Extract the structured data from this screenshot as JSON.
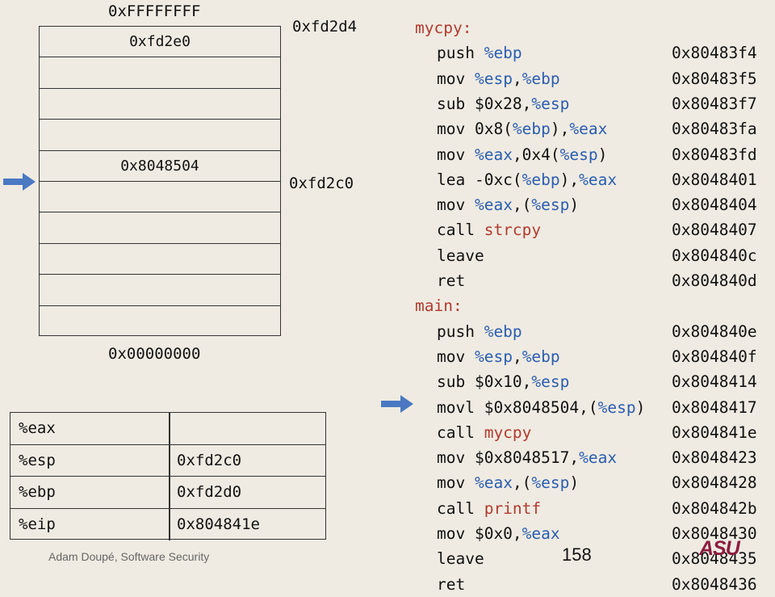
{
  "stack": {
    "top_address_label": "0xFFFFFFFF",
    "bottom_address_label": "0x00000000",
    "side_labels": [
      "0xfd2d4",
      "0xfd2c0"
    ],
    "cells": [
      "0xfd2e0",
      "",
      "",
      "",
      "0x8048504",
      "",
      "",
      "",
      "",
      ""
    ]
  },
  "registers": [
    {
      "name": "%eax",
      "value": ""
    },
    {
      "name": "%esp",
      "value": "0xfd2c0"
    },
    {
      "name": "%ebp",
      "value": "0xfd2d0"
    },
    {
      "name": "%eip",
      "value": "0x804841e"
    }
  ],
  "asm": {
    "mycpy_label": "mycpy:",
    "main_label": "main:",
    "mycpy": [
      {
        "parts": [
          {
            "t": "push ",
            "c": ""
          },
          {
            "t": "%ebp",
            "c": "reg"
          }
        ],
        "addr": "0x80483f4"
      },
      {
        "parts": [
          {
            "t": "mov ",
            "c": ""
          },
          {
            "t": "%esp",
            "c": "reg"
          },
          {
            "t": ",",
            "c": ""
          },
          {
            "t": "%ebp",
            "c": "reg"
          }
        ],
        "addr": "0x80483f5"
      },
      {
        "parts": [
          {
            "t": "sub $0x28,",
            "c": ""
          },
          {
            "t": "%esp",
            "c": "reg"
          }
        ],
        "addr": "0x80483f7"
      },
      {
        "parts": [
          {
            "t": "mov 0x8(",
            "c": ""
          },
          {
            "t": "%ebp",
            "c": "reg"
          },
          {
            "t": "),",
            "c": ""
          },
          {
            "t": "%eax",
            "c": "reg"
          }
        ],
        "addr": "0x80483fa"
      },
      {
        "parts": [
          {
            "t": "mov ",
            "c": ""
          },
          {
            "t": "%eax",
            "c": "reg"
          },
          {
            "t": ",0x4(",
            "c": ""
          },
          {
            "t": "%esp",
            "c": "reg"
          },
          {
            "t": ")",
            "c": ""
          }
        ],
        "addr": "0x80483fd"
      },
      {
        "parts": [
          {
            "t": "lea -0xc(",
            "c": ""
          },
          {
            "t": "%ebp",
            "c": "reg"
          },
          {
            "t": "),",
            "c": ""
          },
          {
            "t": "%eax",
            "c": "reg"
          }
        ],
        "addr": "0x8048401"
      },
      {
        "parts": [
          {
            "t": "mov ",
            "c": ""
          },
          {
            "t": "%eax",
            "c": "reg"
          },
          {
            "t": ",(",
            "c": ""
          },
          {
            "t": "%esp",
            "c": "reg"
          },
          {
            "t": ")",
            "c": ""
          }
        ],
        "addr": "0x8048404"
      },
      {
        "parts": [
          {
            "t": "call ",
            "c": ""
          },
          {
            "t": "strcpy",
            "c": "fn"
          }
        ],
        "addr": "0x8048407"
      },
      {
        "parts": [
          {
            "t": "leave",
            "c": ""
          }
        ],
        "addr": "0x804840c"
      },
      {
        "parts": [
          {
            "t": "ret",
            "c": ""
          }
        ],
        "addr": "0x804840d"
      }
    ],
    "main": [
      {
        "parts": [
          {
            "t": "push ",
            "c": ""
          },
          {
            "t": "%ebp",
            "c": "reg"
          }
        ],
        "addr": "0x804840e"
      },
      {
        "parts": [
          {
            "t": "mov ",
            "c": ""
          },
          {
            "t": "%esp",
            "c": "reg"
          },
          {
            "t": ",",
            "c": ""
          },
          {
            "t": "%ebp",
            "c": "reg"
          }
        ],
        "addr": "0x804840f"
      },
      {
        "parts": [
          {
            "t": "sub $0x10,",
            "c": ""
          },
          {
            "t": "%esp",
            "c": "reg"
          }
        ],
        "addr": "0x8048414"
      },
      {
        "parts": [
          {
            "t": "movl $0x8048504,(",
            "c": ""
          },
          {
            "t": "%esp",
            "c": "reg"
          },
          {
            "t": ")",
            "c": ""
          }
        ],
        "addr": "0x8048417"
      },
      {
        "parts": [
          {
            "t": "call ",
            "c": ""
          },
          {
            "t": "mycpy",
            "c": "fn"
          }
        ],
        "addr": "0x804841e"
      },
      {
        "parts": [
          {
            "t": "mov $0x8048517,",
            "c": ""
          },
          {
            "t": "%eax",
            "c": "reg"
          }
        ],
        "addr": "0x8048423"
      },
      {
        "parts": [
          {
            "t": "mov ",
            "c": ""
          },
          {
            "t": "%eax",
            "c": "reg"
          },
          {
            "t": ",(",
            "c": ""
          },
          {
            "t": "%esp",
            "c": "reg"
          },
          {
            "t": ")",
            "c": ""
          }
        ],
        "addr": "0x8048428"
      },
      {
        "parts": [
          {
            "t": "call ",
            "c": ""
          },
          {
            "t": "printf",
            "c": "fn"
          }
        ],
        "addr": "0x804842b"
      },
      {
        "parts": [
          {
            "t": "mov $0x0,",
            "c": ""
          },
          {
            "t": "%eax",
            "c": "reg"
          }
        ],
        "addr": "0x8048430"
      },
      {
        "parts": [
          {
            "t": "leave",
            "c": ""
          }
        ],
        "addr": "0x8048435"
      },
      {
        "parts": [
          {
            "t": "ret",
            "c": ""
          }
        ],
        "addr": "0x8048436"
      }
    ]
  },
  "icons": {
    "pointer": "arrow-right-icon"
  },
  "colors": {
    "register": "#2a5db0",
    "function": "#b23a2e",
    "arrow": "#4a78c2",
    "asu": "#8c1d40"
  },
  "footer": {
    "author": "Adam Doupé, Software Security",
    "page": "158",
    "logo_text": "ASU"
  }
}
